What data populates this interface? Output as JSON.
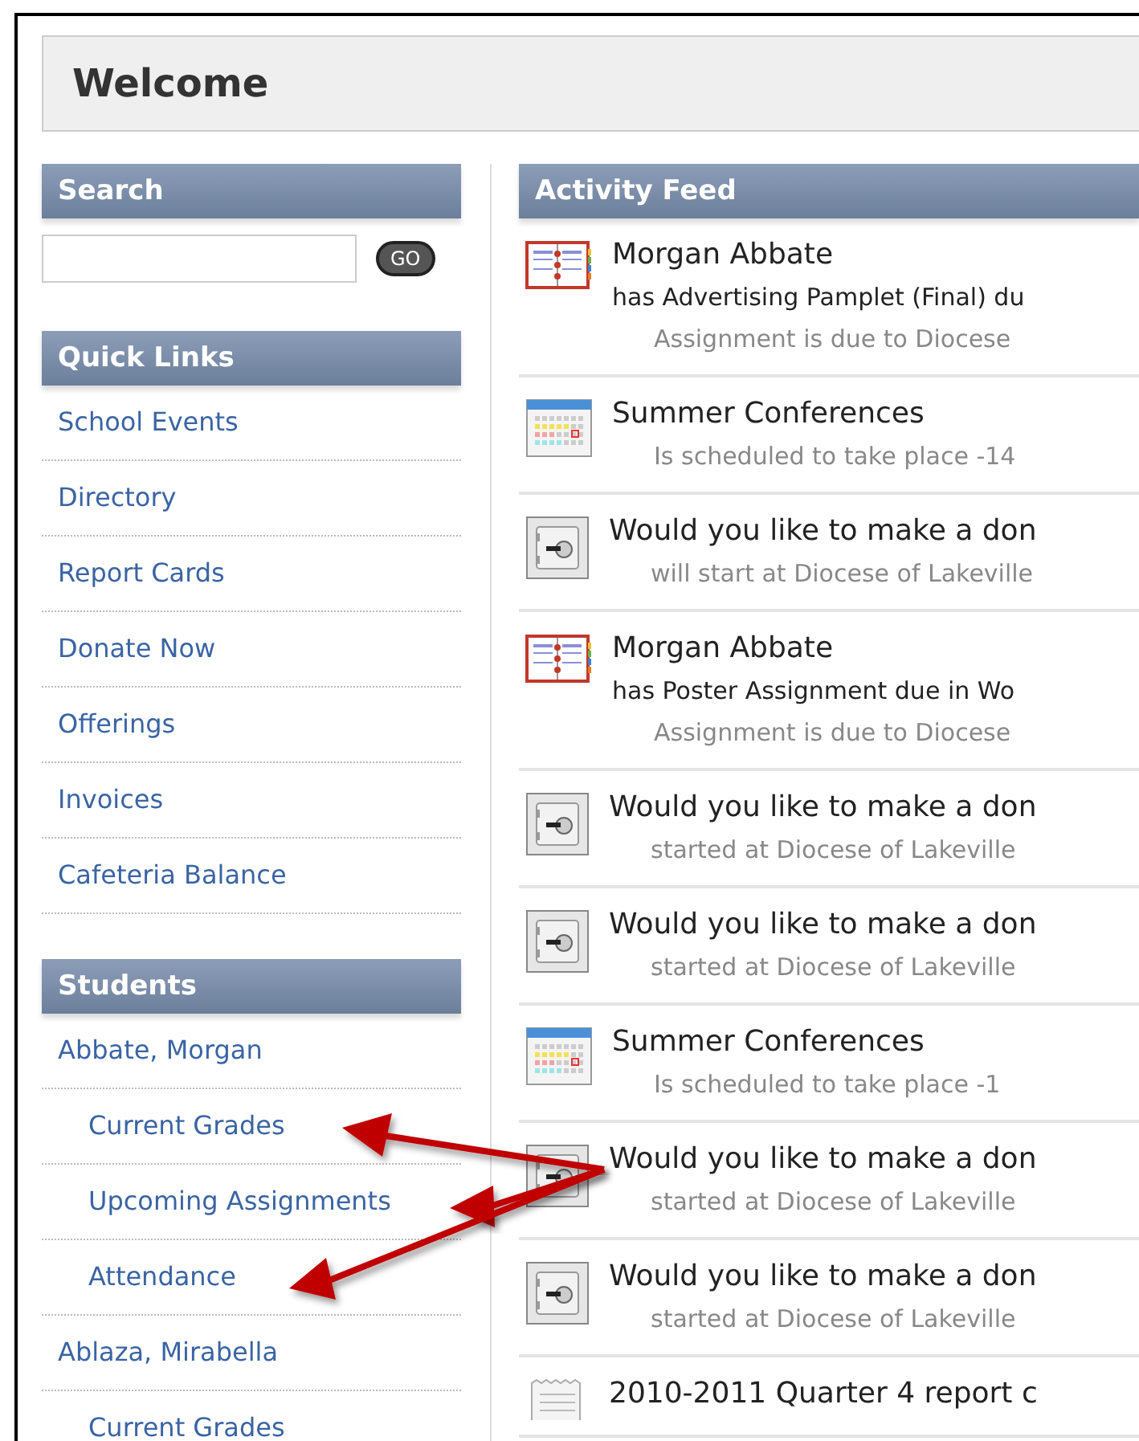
{
  "page": {
    "title": "Welcome"
  },
  "search": {
    "heading": "Search",
    "button": "GO"
  },
  "quick_links": {
    "heading": "Quick Links",
    "items": [
      "School Events",
      "Directory",
      "Report Cards",
      "Donate Now",
      "Offerings",
      "Invoices",
      "Cafeteria Balance"
    ]
  },
  "students": {
    "heading": "Students",
    "items": [
      {
        "name": "Abbate, Morgan",
        "children": [
          "Current Grades",
          "Upcoming Assignments",
          "Attendance"
        ]
      },
      {
        "name": "Ablaza, Mirabella",
        "children": [
          "Current Grades"
        ]
      }
    ]
  },
  "activity_feed": {
    "heading": "Activity Feed",
    "items": [
      {
        "kind": "assignment",
        "title": "Morgan Abbate",
        "line": "has Advertising Pamplet (Final) du",
        "detail": "Assignment is due to Diocese"
      },
      {
        "kind": "event",
        "title": "Summer Conferences",
        "detail": "Is scheduled to take place -14"
      },
      {
        "kind": "donation",
        "title": "Would you like to make a don",
        "detail": "will start at Diocese of Lakeville"
      },
      {
        "kind": "assignment",
        "title": "Morgan Abbate",
        "line": "has Poster Assignment due in Wo",
        "detail": "Assignment is due to Diocese"
      },
      {
        "kind": "donation",
        "title": "Would you like to make a don",
        "detail": "started at Diocese of Lakeville"
      },
      {
        "kind": "donation",
        "title": "Would you like to make a don",
        "detail": "started at Diocese of Lakeville"
      },
      {
        "kind": "event",
        "title": "Summer Conferences",
        "detail": "Is scheduled to take place -1"
      },
      {
        "kind": "donation",
        "title": "Would you like to make a don",
        "detail": "started at Diocese of Lakeville"
      },
      {
        "kind": "donation",
        "title": "Would you like to make a don",
        "detail": "started at Diocese of Lakeville"
      },
      {
        "kind": "report",
        "title": "2010-2011 Quarter 4 report c"
      }
    ]
  }
}
